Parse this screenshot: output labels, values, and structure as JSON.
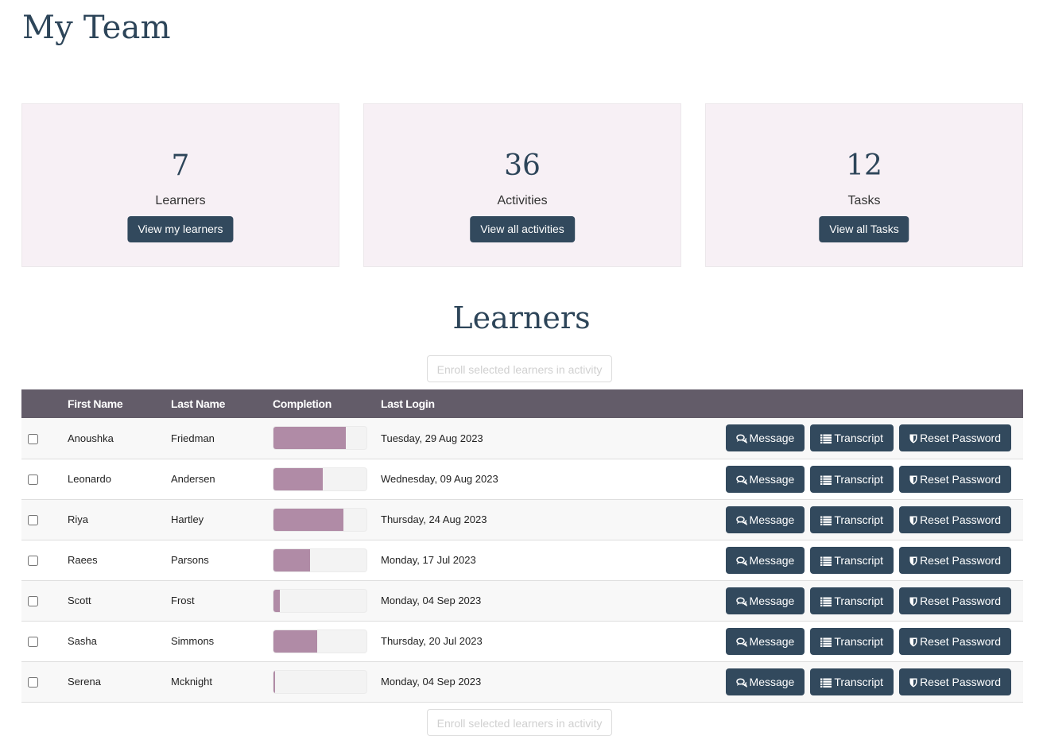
{
  "page": {
    "title": "My Team"
  },
  "stats": [
    {
      "value": "7",
      "label": "Learners",
      "button": "View my learners"
    },
    {
      "value": "36",
      "label": "Activities",
      "button": "View all activities"
    },
    {
      "value": "12",
      "label": "Tasks",
      "button": "View all Tasks"
    }
  ],
  "learners_section": {
    "title": "Learners",
    "enroll_button": "Enroll selected learners in activity"
  },
  "table": {
    "headers": [
      "",
      "First Name",
      "Last Name",
      "Completion",
      "Last Login",
      ""
    ],
    "action_labels": {
      "message": "Message",
      "transcript": "Transcript",
      "reset_password": "Reset Password"
    },
    "icons": {
      "message": "comments-icon",
      "transcript": "list-icon",
      "reset_password": "shield-icon"
    },
    "rows": [
      {
        "first": "Anoushka",
        "last": "Friedman",
        "completion_pct": 78,
        "last_login": "Tuesday, 29 Aug 2023",
        "checked": false
      },
      {
        "first": "Leonardo",
        "last": "Andersen",
        "completion_pct": 53,
        "last_login": "Wednesday, 09 Aug 2023",
        "checked": false
      },
      {
        "first": "Riya",
        "last": "Hartley",
        "completion_pct": 75,
        "last_login": "Thursday, 24 Aug 2023",
        "checked": false
      },
      {
        "first": "Raees",
        "last": "Parsons",
        "completion_pct": 39,
        "last_login": "Monday, 17 Jul 2023",
        "checked": false
      },
      {
        "first": "Scott",
        "last": "Frost",
        "completion_pct": 7,
        "last_login": "Monday, 04 Sep 2023",
        "checked": false
      },
      {
        "first": "Sasha",
        "last": "Simmons",
        "completion_pct": 47,
        "last_login": "Thursday, 20 Jul 2023",
        "checked": false
      },
      {
        "first": "Serena",
        "last": "Mcknight",
        "completion_pct": 2,
        "last_login": "Monday, 04 Sep 2023",
        "checked": false
      }
    ]
  },
  "colors": {
    "primary_button": "#32495d",
    "table_header": "#635c69",
    "progress_fill": "#b08ba6",
    "stat_card_bg": "#f7f0f5",
    "title_text": "#2d4559"
  }
}
